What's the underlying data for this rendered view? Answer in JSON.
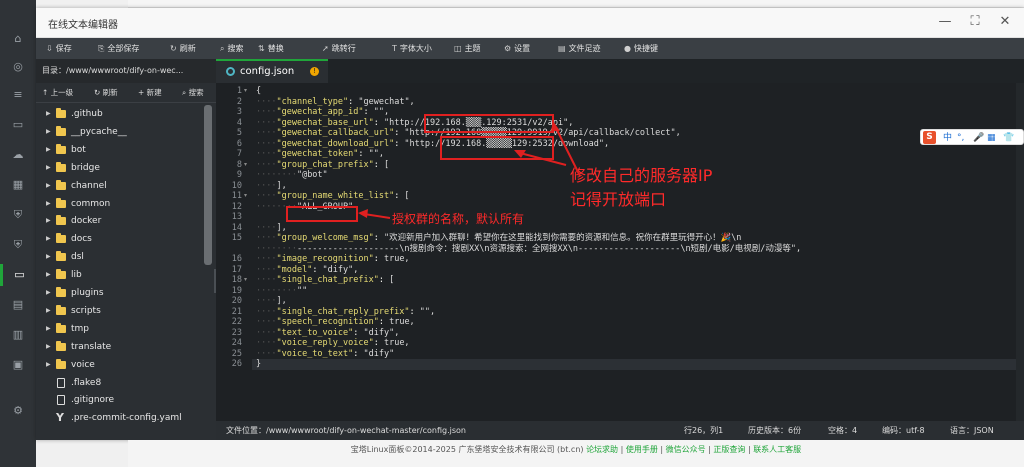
{
  "window": {
    "title": "在线文本编辑器",
    "min": "—",
    "max": "⛶",
    "close": "✕"
  },
  "toolbar": [
    {
      "icon": "⇩",
      "label": "保存",
      "name": "save"
    },
    {
      "icon": "⎘",
      "label": "全部保存",
      "name": "save-all"
    },
    {
      "icon": "↻",
      "label": "刷新",
      "name": "refresh"
    },
    {
      "icon": "⌕",
      "label": "搜索",
      "name": "search"
    },
    {
      "icon": "⇅",
      "label": "替换",
      "name": "replace"
    },
    {
      "icon": "➚",
      "label": "跳转行",
      "name": "goto-line"
    },
    {
      "icon": "T",
      "label": "字体大小",
      "name": "font-size"
    },
    {
      "icon": "◫",
      "label": "主题",
      "name": "theme"
    },
    {
      "icon": "⚙",
      "label": "设置",
      "name": "settings"
    },
    {
      "icon": "▤",
      "label": "文件足迹",
      "name": "file-history"
    },
    {
      "icon": "●",
      "label": "快捷键",
      "name": "shortcuts"
    }
  ],
  "filepanel": {
    "dir": "目录：/www/wwwroot/dify-on-wec...",
    "actions": [
      {
        "icon": "↑",
        "label": "上一级",
        "name": "up-level"
      },
      {
        "icon": "↻",
        "label": "刷新",
        "name": "refresh-files"
      },
      {
        "icon": "+",
        "label": "新建",
        "name": "new-file"
      },
      {
        "icon": "⌕",
        "label": "搜索",
        "name": "search-files"
      }
    ],
    "items": [
      {
        "type": "dir",
        "name": ".github"
      },
      {
        "type": "dir",
        "name": "__pycache__"
      },
      {
        "type": "dir",
        "name": "bot"
      },
      {
        "type": "dir",
        "name": "bridge"
      },
      {
        "type": "dir",
        "name": "channel"
      },
      {
        "type": "dir",
        "name": "common"
      },
      {
        "type": "dir",
        "name": "docker"
      },
      {
        "type": "dir",
        "name": "docs"
      },
      {
        "type": "dir",
        "name": "dsl"
      },
      {
        "type": "dir",
        "name": "lib"
      },
      {
        "type": "dir",
        "name": "plugins"
      },
      {
        "type": "dir",
        "name": "scripts"
      },
      {
        "type": "dir",
        "name": "tmp"
      },
      {
        "type": "dir",
        "name": "translate"
      },
      {
        "type": "dir",
        "name": "voice"
      },
      {
        "type": "file",
        "name": ".flake8"
      },
      {
        "type": "file",
        "name": ".gitignore"
      },
      {
        "type": "yaml",
        "name": ".pre-commit-config.yaml"
      }
    ]
  },
  "tab": {
    "name": "config.json",
    "modified": "!"
  },
  "code": [
    {
      "n": "1",
      "fold": "▾",
      "t": "{"
    },
    {
      "n": "2",
      "fold": "",
      "t": "    \"channel_type\": \"gewechat\","
    },
    {
      "n": "3",
      "fold": "",
      "t": "    \"gewechat_app_id\": \"\","
    },
    {
      "n": "4",
      "fold": "",
      "t": "    \"gewechat_base_url\": \"http://192.168.▒▒▒.129:2531/v2/api\","
    },
    {
      "n": "5",
      "fold": "",
      "t": "    \"gewechat_callback_url\": \"http://192.168▒▒▒▒▒129:9919/v2/api/callback/collect\","
    },
    {
      "n": "6",
      "fold": "",
      "t": "    \"gewechat_download_url\": \"http://192.168.▒▒▒▒▒129:2532/download\","
    },
    {
      "n": "7",
      "fold": "",
      "t": "    \"gewechat_token\": \"\","
    },
    {
      "n": "8",
      "fold": "▾",
      "t": "    \"group_chat_prefix\": ["
    },
    {
      "n": "9",
      "fold": "",
      "t": "        \"@bot\""
    },
    {
      "n": "10",
      "fold": "",
      "t": "    ],"
    },
    {
      "n": "11",
      "fold": "▾",
      "t": "    \"group_name_white_list\": ["
    },
    {
      "n": "12",
      "fold": "",
      "t": "        \"ALL_GROUP\""
    },
    {
      "n": "13",
      "fold": "",
      "t": ""
    },
    {
      "n": "14",
      "fold": "",
      "t": "    ],"
    },
    {
      "n": "15",
      "fold": "",
      "t": "    \"group_welcome_msg\": \"欢迎新用户加入群聊！希望你在这里能找到你需要的资源和信息。祝你在群里玩得开心！🎉\\n"
    },
    {
      "n": "",
      "fold": "",
      "t": "        --------------------\\n搜剧命令：搜剧XX\\n资源搜索：全网搜XX\\n--------------------\\n短剧/电影/电视剧/动漫等\","
    },
    {
      "n": "16",
      "fold": "",
      "t": "    \"image_recognition\": true,"
    },
    {
      "n": "17",
      "fold": "",
      "t": "    \"model\": \"dify\","
    },
    {
      "n": "18",
      "fold": "▾",
      "t": "    \"single_chat_prefix\": ["
    },
    {
      "n": "19",
      "fold": "",
      "t": "        \"\""
    },
    {
      "n": "20",
      "fold": "",
      "t": "    ],"
    },
    {
      "n": "21",
      "fold": "",
      "t": "    \"single_chat_reply_prefix\": \"\","
    },
    {
      "n": "22",
      "fold": "",
      "t": "    \"speech_recognition\": true,"
    },
    {
      "n": "23",
      "fold": "",
      "t": "    \"text_to_voice\": \"dify\","
    },
    {
      "n": "24",
      "fold": "",
      "t": "    \"voice_reply_voice\": true,"
    },
    {
      "n": "25",
      "fold": "",
      "t": "    \"voice_to_text\": \"dify\""
    },
    {
      "n": "26",
      "fold": "",
      "t": "}"
    }
  ],
  "annotations": {
    "ip_line1": "修改自己的服务器IP",
    "ip_line2": "记得开放端口",
    "group_note": "授权群的名称，默认所有"
  },
  "status": {
    "path": "文件位置：/www/wwwroot/dify-on-wechat-master/config.json",
    "pos": "行26，列1",
    "history": "历史版本：6份",
    "indent": "空格：4",
    "encoding": "编码：utf-8",
    "lang": "语言：JSON"
  },
  "footer": {
    "copy": "宝塔Linux面板©2014-2025 广东堡塔安全技术有限公司 (bt.cn)",
    "links": [
      "论坛求助",
      "使用手册",
      "微信公众号",
      "正版查询",
      "联系人工客服"
    ]
  },
  "ime": {
    "logo": "S",
    "items": [
      "中",
      "°,",
      "🎤",
      "▦",
      "👕"
    ]
  }
}
